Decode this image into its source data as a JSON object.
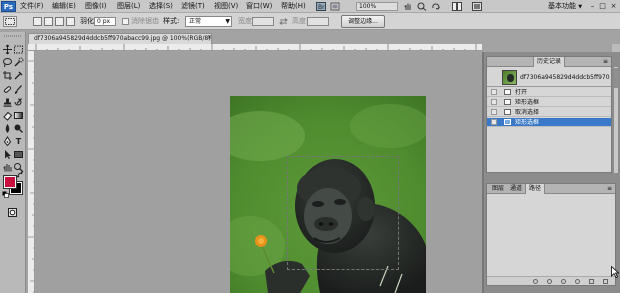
{
  "menubar": {
    "logo": "Ps",
    "items": [
      "文件(F)",
      "编辑(E)",
      "图像(I)",
      "图层(L)",
      "选择(S)",
      "滤镜(T)",
      "视图(V)",
      "窗口(W)",
      "帮助(H)"
    ],
    "zoom": "100%",
    "workspace": "基本功能",
    "workspace_arrow": "▼",
    "win_minimize": "–",
    "win_restore": "□",
    "win_close": "×"
  },
  "options": {
    "feather_label": "羽化:",
    "feather_value": "0 px",
    "antialias_label": "消除锯齿",
    "style_label": "样式:",
    "style_value": "正常",
    "width_label": "宽度:",
    "height_label": "高度:",
    "refine_button": "调整边缘..."
  },
  "document": {
    "tab_title": "df7306a945829d4ddcb5ff970abacc99.jpg @ 100%(RGB/8)",
    "tab_modified": "*",
    "close": "×"
  },
  "history": {
    "tabs": [
      "历史记录"
    ],
    "snapshot_name": "df7306a945829d4ddcb5ff970abacc...",
    "rows": [
      "打开",
      "矩形选框",
      "取消选择",
      "矩形选框"
    ],
    "selected_index": 3
  },
  "layers": {
    "tabs": [
      "图层",
      "通道",
      "路径"
    ],
    "active_tab_index": 2
  },
  "colors": {
    "foreground": "#c8103f",
    "background": "#000000",
    "selection_highlight": "#3a78c8"
  }
}
